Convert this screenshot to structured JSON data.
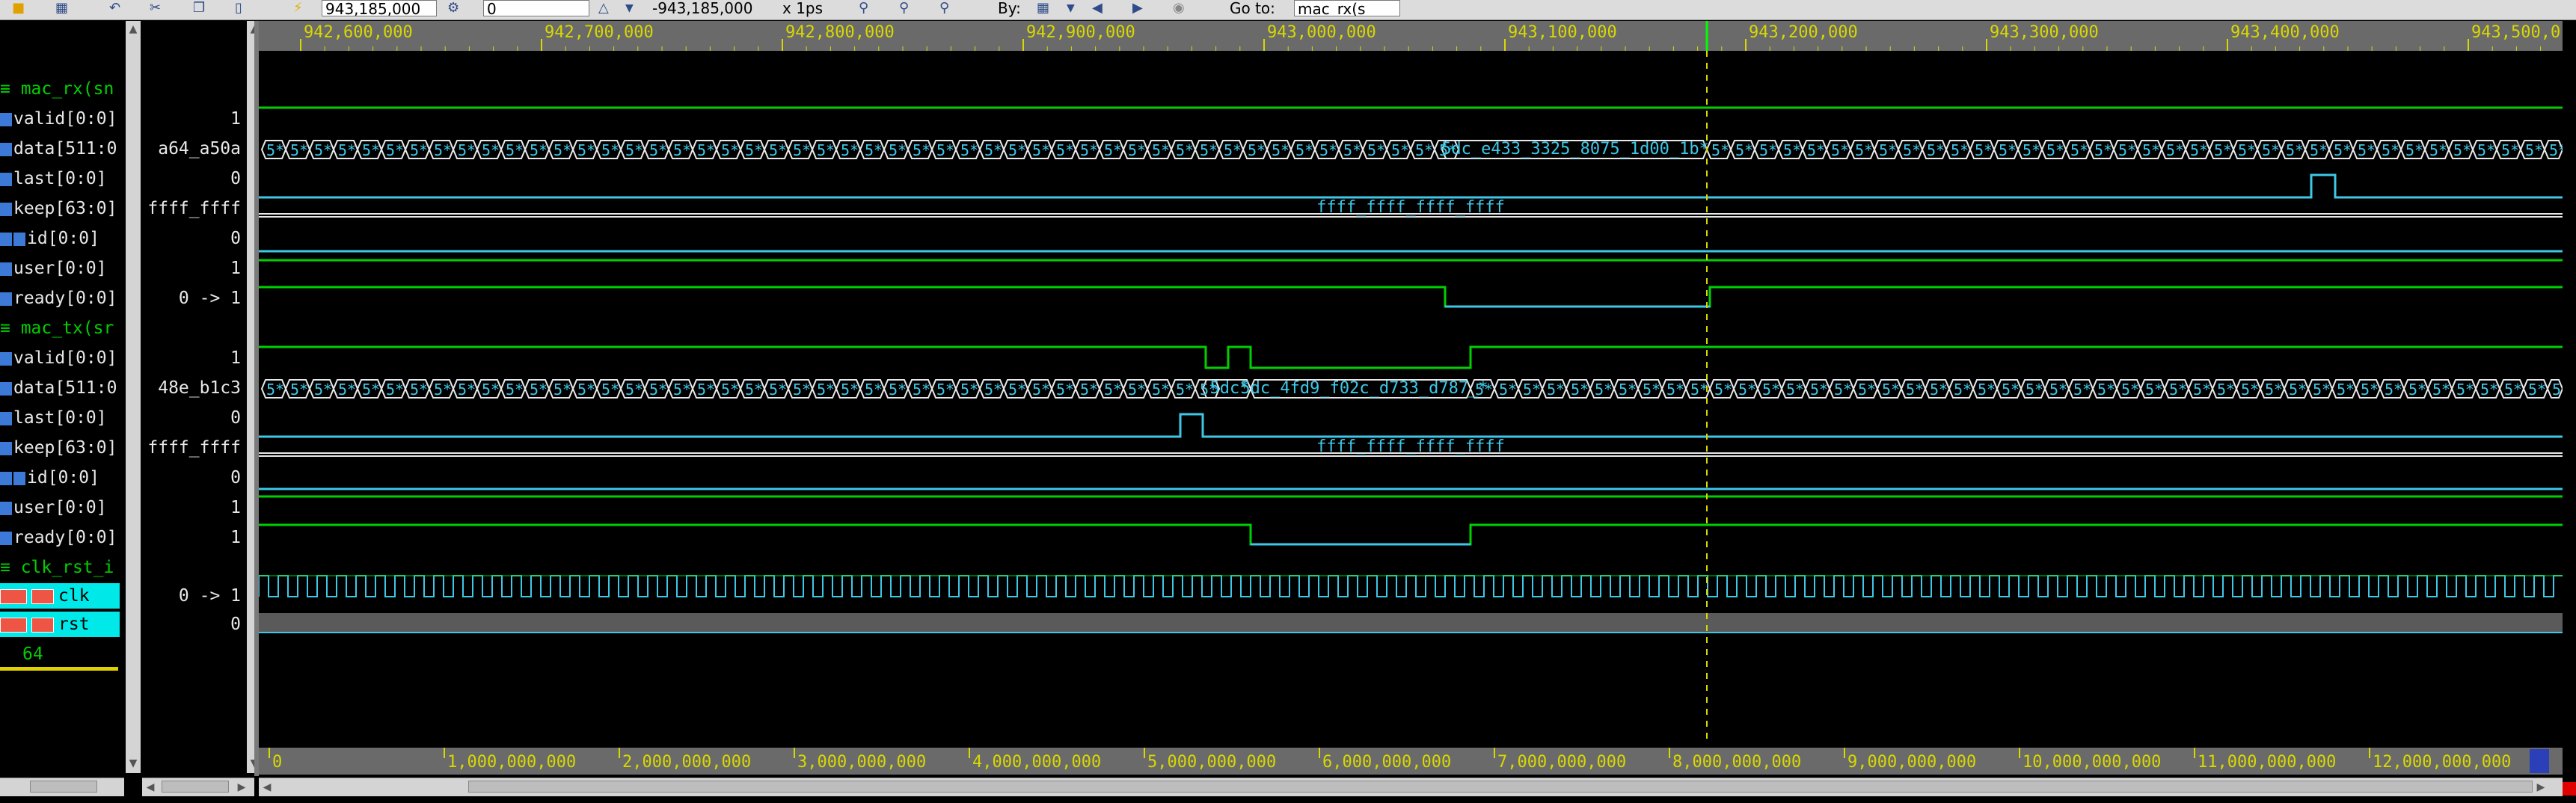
{
  "toolbar": {
    "cursor_time": "943,185,000",
    "delta_value": "0",
    "delta_time": "-943,185,000",
    "unit": "x 1ps",
    "by_label": "By:",
    "goto_label": "Go to:",
    "goto_value": "mac_rx(s"
  },
  "ruler": {
    "top_labels": [
      "942,600,000",
      "942,700,000",
      "942,800,000",
      "942,900,000",
      "943,000,000",
      "943,100,000",
      "943,200,000",
      "943,300,000",
      "943,400,000",
      "943,500,0"
    ],
    "bottom_labels": [
      "0",
      "1,000,000,000",
      "2,000,000,000",
      "3,000,000,000",
      "4,000,000,000",
      "5,000,000,000",
      "6,000,000,000",
      "7,000,000,000",
      "8,000,000,000",
      "9,000,000,000",
      "10,000,000,000",
      "11,000,000,000",
      "12,000,000,000"
    ]
  },
  "groups": {
    "rx": "mac_rx(sn",
    "tx": "mac_tx(sr",
    "clk": "clk_rst_i"
  },
  "rx": {
    "valid": {
      "name": "valid[0:0]",
      "value": "1"
    },
    "data": {
      "name": "data[511:0]",
      "value": "a64_a50a",
      "bus_label": "5dc_e433_3325_8075_1d00_1b*"
    },
    "last": {
      "name": "last[0:0]",
      "value": "0"
    },
    "keep": {
      "name": "keep[63:0]",
      "value": "ffff_ffff",
      "bus_label": "ffff_ffff_ffff_ffff"
    },
    "id": {
      "name": "id[0:0]",
      "value": "0"
    },
    "user": {
      "name": "user[0:0]",
      "value": "1"
    },
    "ready": {
      "name": "ready[0:0]",
      "value": "0 -> 1"
    }
  },
  "tx": {
    "valid": {
      "name": "valid[0:0]",
      "value": "1"
    },
    "data": {
      "name": "data[511:0]",
      "value": "48e_b1c3",
      "bus_label_1": "5dc*",
      "bus_label_2": "5dc_4fd9_f02c_d733_d787_*"
    },
    "last": {
      "name": "last[0:0]",
      "value": "0"
    },
    "keep": {
      "name": "keep[63:0]",
      "value": "ffff_ffff",
      "bus_label": "ffff_ffff_ffff_ffff"
    },
    "id": {
      "name": "id[0:0]",
      "value": "0"
    },
    "user": {
      "name": "user[0:0]",
      "value": "1"
    },
    "ready": {
      "name": "ready[0:0]",
      "value": "1"
    }
  },
  "clk_group": {
    "clk": {
      "name": "clk",
      "value": "0 -> 1"
    },
    "rst": {
      "name": "rst",
      "value": "0"
    },
    "count": "64"
  },
  "colors": {
    "wave_green": "#00d000",
    "wave_cyan": "#3ec8e8",
    "ruler_text": "#d8d800",
    "cursor": "#d8d800"
  }
}
